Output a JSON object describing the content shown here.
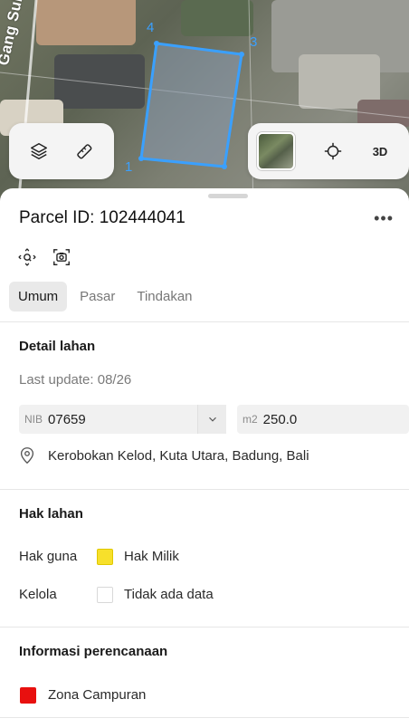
{
  "map": {
    "street_label": "Gang Suli",
    "vertices": [
      "4",
      "3",
      "1"
    ],
    "toolbar_left": [
      {
        "icon": "layers-icon"
      },
      {
        "icon": "measure-icon"
      }
    ],
    "toolbar_right": {
      "thumbnail_icon": "satellite-thumbnail",
      "locate_icon": "crosshair-icon",
      "view_3d_label": "3D"
    },
    "parcel_color": "#3aa0ff"
  },
  "parcel": {
    "title": "Parcel ID: 102444041",
    "more_label": "•••",
    "tabs": [
      {
        "label": "Umum",
        "active": true
      },
      {
        "label": "Pasar",
        "active": false
      },
      {
        "label": "Tindakan",
        "active": false
      }
    ]
  },
  "detail": {
    "section_title": "Detail lahan",
    "last_update": "Last update: 08/26",
    "nib_prefix": "NIB",
    "nib_value": "07659",
    "area_prefix": "m2",
    "area_value": "250.0",
    "address": "Kerobokan Kelod, Kuta Utara, Badung, Bali"
  },
  "rights": {
    "section_title": "Hak lahan",
    "rows": [
      {
        "label": "Hak guna",
        "value": "Hak Milik",
        "color": "#f7e02b"
      },
      {
        "label": "Kelola",
        "value": "Tidak ada data",
        "color": "#ffffff"
      }
    ]
  },
  "planning": {
    "section_title": "Informasi perencanaan",
    "zone_label": "Zona Campuran",
    "zone_color": "#e8100f"
  }
}
